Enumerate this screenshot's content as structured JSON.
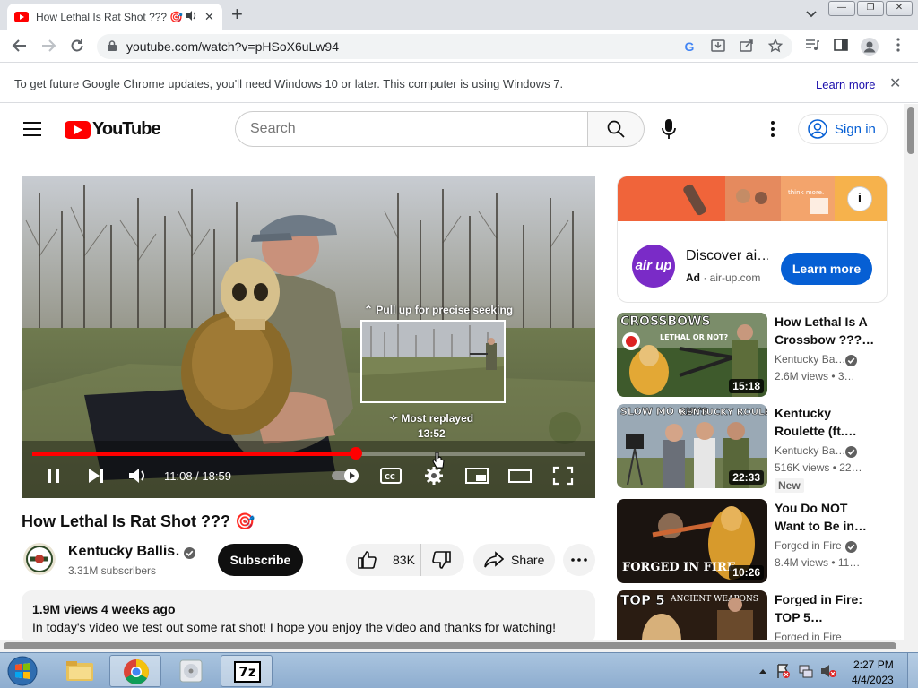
{
  "browser": {
    "tab_title": "How Lethal Is Rat Shot ??? 🎯",
    "tab_audio_icon": "speaker-icon",
    "tab_close": "✕",
    "new_tab": "+",
    "url": "youtube.com/watch?v=pHSoX6uLw94",
    "window_buttons": [
      "—",
      "❐",
      "✕"
    ]
  },
  "infobar": {
    "message": "To get future Google Chrome updates, you'll need Windows 10 or later. This computer is using Windows 7.",
    "link": "Learn more",
    "close": "✕"
  },
  "youtube_header": {
    "logo_text": "YouTube",
    "search_placeholder": "Search",
    "sign_in": "Sign in"
  },
  "player": {
    "seek_hint": "⌃ Pull up for precise seeking",
    "most_replayed": "✧ Most replayed",
    "preview_time": "13:52",
    "current_time": "11:08",
    "duration": "18:59",
    "time_readout": "11:08 / 18:59",
    "progress_fraction": 0.586,
    "colors": {
      "progress": "#ff0000"
    }
  },
  "video": {
    "title": "How Lethal Is Rat Shot ??? 🎯",
    "channel_name": "Kentucky Ballis…",
    "subscribers": "3.31M subscribers",
    "subscribe_label": "Subscribe",
    "likes": "83K",
    "share_label": "Share",
    "views_and_date": "1.9M views  4 weeks ago",
    "description": "In today's video we test out some rat shot! I hope you enjoy the video and thanks for watching!"
  },
  "ad": {
    "logo_text": "air up",
    "title": "Discover ai…",
    "label": "Ad",
    "domain": "air-up.com",
    "button": "Learn more",
    "info": "i"
  },
  "recommendations": [
    {
      "title": "How Lethal Is A Crossbow ???…",
      "channel": "Kentucky Ba…",
      "meta": "2.6M views • 3…",
      "duration": "15:18",
      "badge": "",
      "thumb_text": "CROSSBOWS",
      "thumb_sub": "LETHAL OR NOT?"
    },
    {
      "title": "Kentucky Roulette (ft.…",
      "channel": "Kentucky Ba…",
      "meta": "516K views • 22…",
      "duration": "22:33",
      "badge": "New",
      "thumb_text": "SLOW MO GUYS",
      "thumb_sub": "KENTUCKY ROULETTE"
    },
    {
      "title": "You Do NOT Want to Be in…",
      "channel": "Forged in Fire",
      "meta": "8.4M views • 11…",
      "duration": "10:26",
      "badge": "",
      "thumb_text": "FORGED IN FIRE",
      "thumb_sub": ""
    },
    {
      "title": "Forged in Fire: TOP 5…",
      "channel": "Forged in Fire",
      "meta": "",
      "duration": "",
      "badge": "",
      "thumb_text": "TOP 5",
      "thumb_sub": "ANCIENT WEAPONS"
    }
  ],
  "taskbar": {
    "time": "2:27 PM",
    "date": "4/4/2023",
    "apps": [
      "windows-explorer-icon",
      "chrome-icon",
      "media-player-icon",
      "7zip-icon"
    ],
    "app_7z_label": "7z"
  }
}
